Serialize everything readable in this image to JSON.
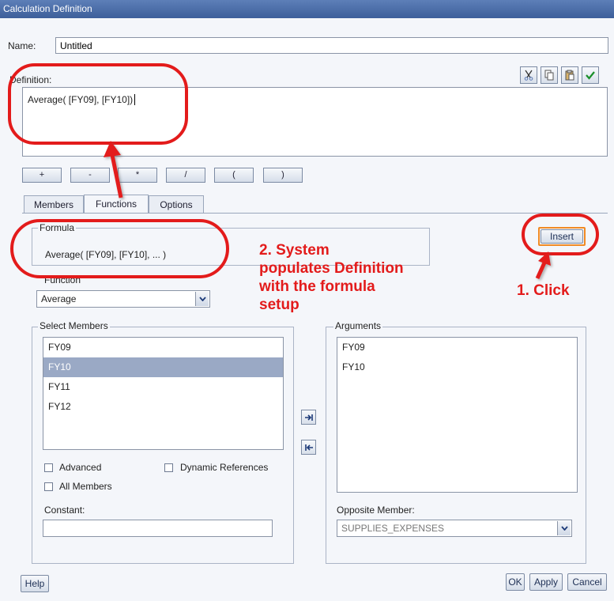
{
  "window": {
    "title": "Calculation Definition"
  },
  "name": {
    "label": "Name:",
    "value": "Untitled"
  },
  "definition": {
    "label": "Definition:",
    "text": "Average( [FY09], [FY10])"
  },
  "toolbar": {
    "icons": [
      "cut-icon",
      "copy-icon",
      "paste-icon",
      "checkmark-icon"
    ]
  },
  "operators": [
    "+",
    "-",
    "*",
    "/",
    "(",
    ")"
  ],
  "tabs": [
    {
      "label": "Members"
    },
    {
      "label": "Functions"
    },
    {
      "label": "Options"
    }
  ],
  "formula": {
    "legend": "Formula",
    "text": "Average( [FY09], [FY10], ... )"
  },
  "insert_label": "Insert",
  "function": {
    "label": "Function",
    "selected": "Average"
  },
  "select_members": {
    "legend": "Select Members",
    "items": [
      "FY09",
      "FY10",
      "FY11",
      "FY12"
    ],
    "selected_index": 1
  },
  "arguments": {
    "legend": "Arguments",
    "items": [
      "FY09",
      "FY10"
    ]
  },
  "options": {
    "advanced": "Advanced",
    "dynamic_references": "Dynamic References",
    "all_members": "All Members"
  },
  "constant": {
    "label": "Constant:",
    "value": ""
  },
  "opposite_member": {
    "label": "Opposite Member:",
    "selected": "SUPPLIES_EXPENSES"
  },
  "footer": {
    "help": "Help",
    "ok": "OK",
    "apply": "Apply",
    "cancel": "Cancel"
  },
  "annotations": {
    "step2": [
      "2. System",
      "populates Definition",
      "with the formula",
      "setup"
    ],
    "step1": "1. Click"
  },
  "colors": {
    "annotation": "#e31b1b",
    "titlebar": "#3d5f9a",
    "selection": "#9aa9c5",
    "insert_highlight": "#f08a24"
  }
}
